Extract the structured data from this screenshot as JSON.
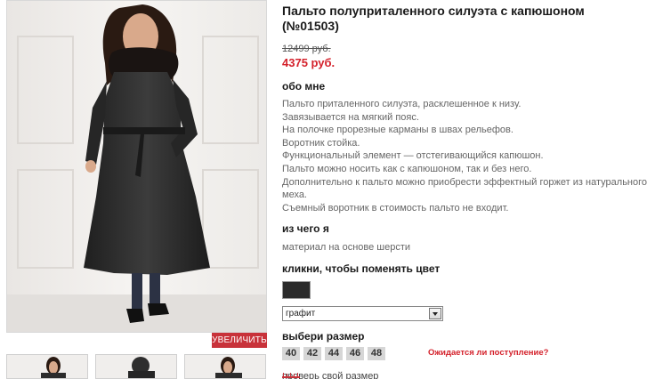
{
  "product": {
    "title_line1": "Пальто полуприталенного силуэта с капюшоном",
    "title_line2": "(№01503)",
    "old_price": "12499 руб.",
    "new_price": "4375 руб."
  },
  "about": {
    "heading": "обо мне",
    "lines": [
      "Пальто приталенного силуэта, расклешенное к низу.",
      "Завязывается на мягкий пояс.",
      "На полочке прорезные карманы в швах рельефов.",
      "Воротник стойка.",
      "Функциональный элемент — отстегивающийся капюшон.",
      "Пальто можно носить как с капюшоном, так и без него.",
      "Дополнительно к пальто можно приобрести эффектный горжет из натурального меха.",
      "Съемный воротник в стоимость пальто не входит."
    ]
  },
  "material": {
    "heading": "из чего я",
    "text": "материал на основе шерсти"
  },
  "color": {
    "heading": "кликни, чтобы поменять цвет",
    "swatch_color": "#2b2b2b",
    "selected": "графит"
  },
  "size": {
    "heading": "выбери размер",
    "options": [
      "40",
      "42",
      "44",
      "46",
      "48"
    ],
    "expected_link": "Ожидается ли поступление?",
    "check_link": "проверь свой размер"
  },
  "gallery": {
    "zoom_label": "УВЕЛИЧИТЬ"
  },
  "colors": {
    "accent": "#c8323a",
    "price_red": "#d4212b"
  }
}
